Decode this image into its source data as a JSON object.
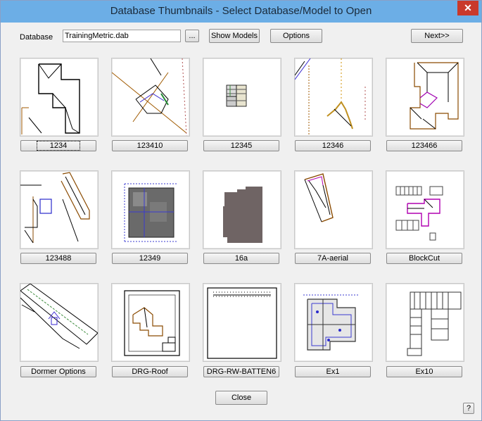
{
  "window": {
    "title": "Database Thumbnails - Select Database/Model to Open",
    "close_glyph": "✕"
  },
  "toolbar": {
    "database_label": "Database",
    "database_value": "TrainingMetric.dab",
    "browse_label": "...",
    "show_models_label": "Show Models",
    "options_label": "Options",
    "next_label": "Next>>"
  },
  "thumbnails": [
    {
      "label": "1234"
    },
    {
      "label": "123410"
    },
    {
      "label": "12345"
    },
    {
      "label": "12346"
    },
    {
      "label": "123466"
    },
    {
      "label": "123488"
    },
    {
      "label": "12349"
    },
    {
      "label": "16a"
    },
    {
      "label": "7A-aerial"
    },
    {
      "label": "BlockCut"
    },
    {
      "label": "Dormer Options"
    },
    {
      "label": "DRG-Roof"
    },
    {
      "label": "DRG-RW-BATTEN6"
    },
    {
      "label": "Ex1"
    },
    {
      "label": "Ex10"
    }
  ],
  "footer": {
    "close_label": "Close",
    "help_label": "?"
  }
}
